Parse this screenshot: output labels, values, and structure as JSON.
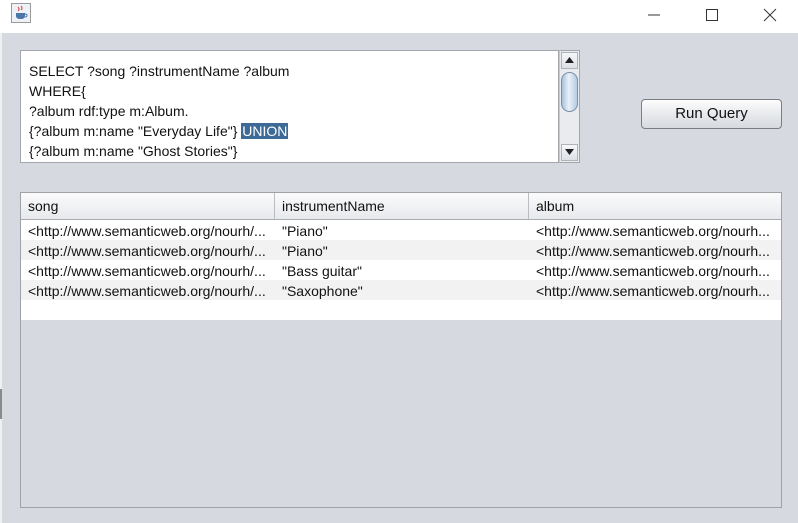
{
  "window": {
    "app_icon": "java-cup-icon",
    "controls": [
      "minimize-icon",
      "maximize-icon",
      "close-icon"
    ]
  },
  "query": {
    "lines": [
      {
        "text": "SELECT ?song ?instrumentName ?album"
      },
      {
        "text": "WHERE{"
      },
      {
        "text": "?album rdf:type m:Album."
      },
      {
        "text": "{?album m:name \"Everyday Life\"} ",
        "highlight": "UNION"
      },
      {
        "text": "{?album m:name \"Ghost Stories\"}"
      }
    ]
  },
  "run_button": {
    "label": "Run Query"
  },
  "results": {
    "columns": [
      "song",
      "instrumentName",
      "album"
    ],
    "rows": [
      [
        "<http://www.semanticweb.org/nourh/...",
        "\"Piano\"",
        "<http://www.semanticweb.org/nourh..."
      ],
      [
        "<http://www.semanticweb.org/nourh/...",
        "\"Piano\"",
        "<http://www.semanticweb.org/nourh..."
      ],
      [
        "<http://www.semanticweb.org/nourh/...",
        "\"Bass guitar\"",
        "<http://www.semanticweb.org/nourh..."
      ],
      [
        "<http://www.semanticweb.org/nourh/...",
        "\"Saxophone\"",
        "<http://www.semanticweb.org/nourh..."
      ]
    ]
  },
  "colors": {
    "panel": "#d6d9df",
    "selection": "#3d6a97",
    "alt_row": "#f2f2f2"
  }
}
